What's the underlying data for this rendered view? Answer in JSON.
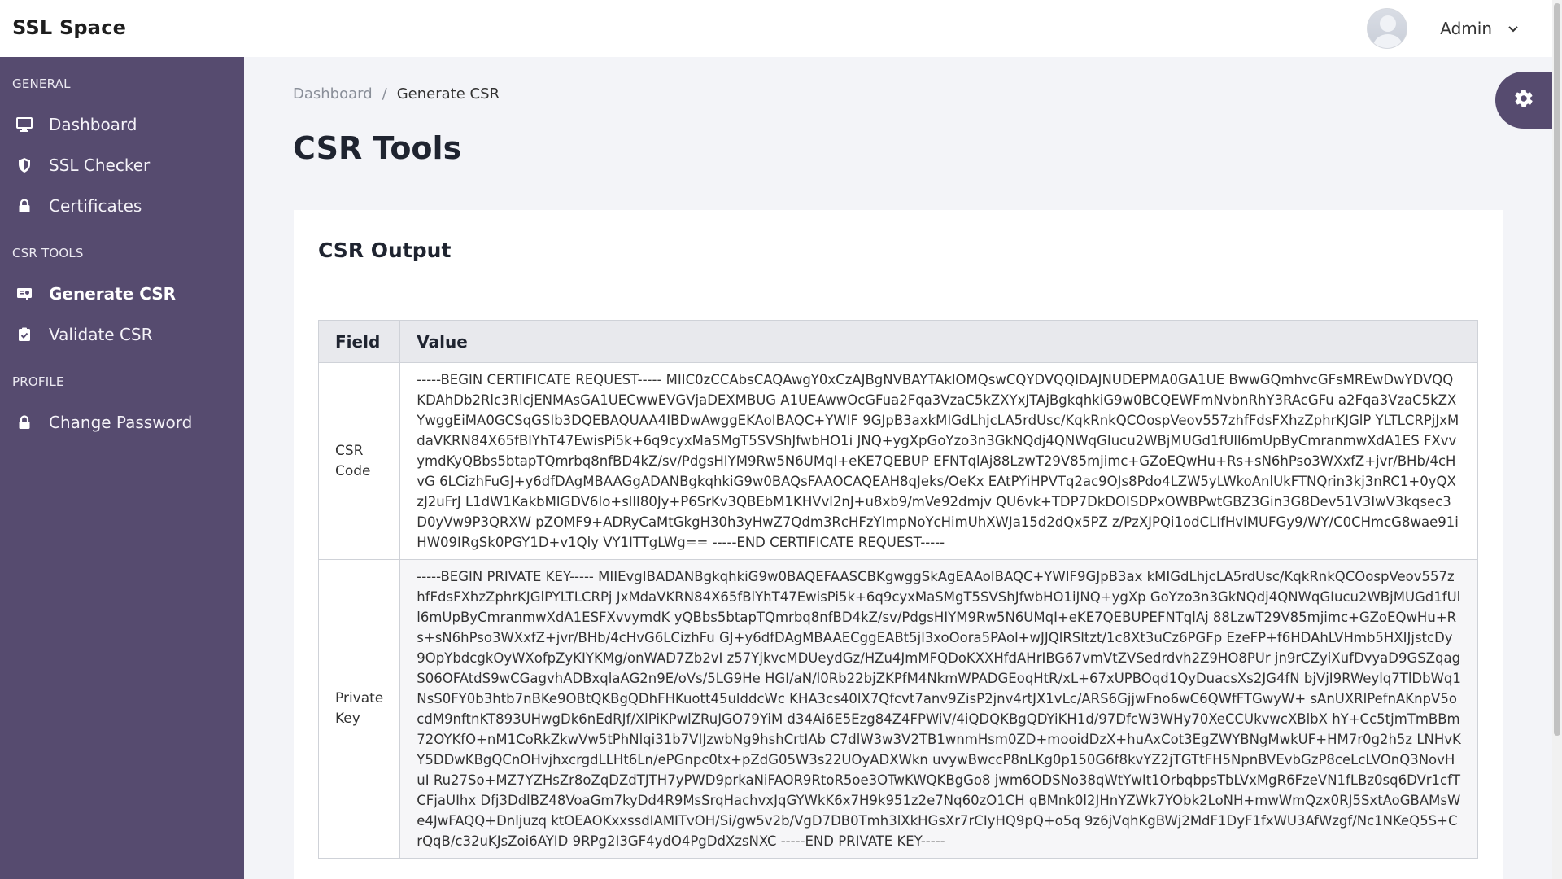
{
  "app": {
    "brand": "SSL Space"
  },
  "user": {
    "name": "Admin"
  },
  "sidebar": {
    "sections": [
      {
        "label": "GENERAL"
      },
      {
        "label": "CSR TOOLS"
      },
      {
        "label": "PROFILE"
      }
    ],
    "items": [
      {
        "label": "Dashboard",
        "icon": "monitor-icon"
      },
      {
        "label": "SSL Checker",
        "icon": "shield-icon"
      },
      {
        "label": "Certificates",
        "icon": "lock-icon"
      },
      {
        "label": "Generate CSR",
        "icon": "csr-icon",
        "active": true
      },
      {
        "label": "Validate CSR",
        "icon": "clipboard-check-icon"
      },
      {
        "label": "Change Password",
        "icon": "lock-icon"
      }
    ]
  },
  "breadcrumb": {
    "parent": "Dashboard",
    "separator": "/",
    "current": "Generate CSR"
  },
  "page": {
    "title": "CSR Tools"
  },
  "card": {
    "title": "CSR Output",
    "table": {
      "headers": [
        "Field",
        "Value"
      ],
      "rows": [
        {
          "field": "CSR Code",
          "value": "-----BEGIN CERTIFICATE REQUEST----- MIIC0zCCAbsCAQAwgY0xCzAJBgNVBAYTAklOMQswCQYDVQQIDAJNUDEPMA0GA1UE BwwGQmhvcGFsMREwDwYDVQQKDAhDb2Rlc3RlcjENMAsGA1UECwwEVGVjaDEXMBUG A1UEAwwOcGFua2Fqa3VzaC5kZXYxJTAjBgkqhkiG9w0BCQEWFmNvbnRhY3RAcGFu a2Fqa3VzaC5kZXYwggEiMA0GCSqGSIb3DQEBAQUAA4IBDwAwggEKAoIBAQC+YWIF 9GJpB3axkMIGdLhjcLA5rdUsc/KqkRnkQCOospVeov557zhfFdsFXhzZphrKJGlP YLTLCRPjJxMdaVKRN84X65fBlYhT47EwisPi5k+6q9cyxMaSMgT5SVShJfwbHO1i JNQ+ygXpGoYzo3n3GkNQdj4QNWqGIucu2WBjMUGd1fUll6mUpByCmranmwXdA1ES FXvvymdKyQBbs5btapTQmrbq8nfBD4kZ/sv/PdgsHIYM9Rw5N6UMqI+eKE7QEBUP EFNTqlAj88LzwT29V85mjimc+GZoEQwHu+Rs+sN6hPso3WXxfZ+jvr/BHb/4cHvG 6LCizhFuGJ+y6dfDAgMBAAGgADANBgkqhkiG9w0BAQsFAAOCAQEAH8qJeks/OeKx EAtPYiHPVTq2ac9OJs8Pdo4LZW5yLWkoAnlUkFTNQrin3kj3nRC1+0yQXzJ2uFrJ L1dW1KakbMlGDV6Io+sllI80Jy+P6SrKv3QBEbM1KHVvl2nJ+u8xb9/mVe92dmjv QU6vk+TDP7DkDOISDPxOWBPwtGBZ3Gin3G8Dev51V3IwV3kqsec3D0yVw9P3QRXW pZOMF9+ADRyCaMtGkgH30h3yHwZ7Qdm3RcHFzYImpNoYcHimUhXWJa15d2dQx5PZ z/PzXJPQi1odCLIfHvlMUFGy9/WY/C0CHmcG8wae91iHW09IRgSk0PGY1D+v1Qly VY1ITTgLWg== -----END CERTIFICATE REQUEST-----"
        },
        {
          "field": "Private Key",
          "value": "-----BEGIN PRIVATE KEY----- MIIEvgIBADANBgkqhkiG9w0BAQEFAASCBKgwggSkAgEAAoIBAQC+YWIF9GJpB3ax kMIGdLhjcLA5rdUsc/KqkRnkQCOospVeov557zhfFdsFXhzZphrKJGlPYLTLCRPj JxMdaVKRN84X65fBlYhT47EwisPi5k+6q9cyxMaSMgT5SVShJfwbHO1iJNQ+ygXp GoYzo3n3GkNQdj4QNWqGIucu2WBjMUGd1fUll6mUpByCmranmwXdA1ESFXvvymdK yQBbs5btapTQmrbq8nfBD4kZ/sv/PdgsHIYM9Rw5N6UMqI+eKE7QEBUPEFNTqlAj 88LzwT29V85mjimc+GZoEQwHu+Rs+sN6hPso3WXxfZ+jvr/BHb/4cHvG6LCizhFu GJ+y6dfDAgMBAAECggEABt5jl3xoOora5PAol+wJJQlRSltzt/1c8Xt3uCz6PGFp EzeFP+f6HDAhLVHmb5HXIJjstcDy9OpYbdcgkOyWXofpZyKIYKMg/onWAD7Zb2vI z57YjkvcMDUeydGz/HZu4JmMFQDoKXXHfdAHrIBG67vmVtZVSedrdvh2Z9HO8PUr jn9rCZyiXufDvyaD9GSZqagS06OFAtdS9wCGagvhADBxqlaAG2n9E/oVs/5LG9He HGI/aN/l0Rb22bjZKPfM4NkmWPADGEoqHtR/xL+67xUPBOqd1QyDuacsXs2JG4fN bjVjI9RWeylq7TlDbWq1NsS0FY0b3htb7nBKe9OBtQKBgQDhFHKuott45ulddcWc KHA3cs40lX7Qfcvt7anv9ZisP2jnv4rtJX1vLc/ARS6GjjwFno6wC6QWfFTGwyW+ sAnUXRlPefnAKnpV5ocdM9nftnKT893UHwgDk6nEdRJf/XlPiKPwlZRuJGO79YiM d34Ai6E5Ezg84Z4FPWiV/4iQDQKBgQDYiKH1d/97DfcW3WHy70XeCCUkvwcXBlbX hY+Cc5tjmTmBBm72OYKfO+nM1CoRkZkwVw5tPhNlqi31b7VIJzwbNg9hshCrtIAb C7dlW3w3V2TB1wnmHsm0ZD+mooidDzX+huAxCot3EgZWYBNgMwkUF+HM7r0g2h5z LNHvKY5DDwKBgQCnOHvjhxcrgdLLHt6Ln/ePGnpc0tx+pZdG05W3s22UOyADXWkn uvywBwccP8nLKg0p150G6f8kvYZ2jTGTtFH5NpnBVEvbGzP8ceLcLVOnQ3NovHuI Ru27So+MZ7YZHsZr8oZqDZdTJTH7yPWD9prkaNiFAOR9RtoR5oe3OTwKWQKBgGo8 jwm6ODSNo38qWtYwIt1OrbqbpsTbLVxMgR6FzeVN1fLBz0sq6DVr1cfTCFjaUIhx Dfj3DdlBZ48VoaGm7kyDd4R9MsSrqHachvxJqGYWkK6x7H9k951z2e7Nq60zO1CH qBMnk0l2JHnYZWk7YObk2LoNH+mwWmQzx0RJ5SxtAoGBAMsWe4JwFAQQ+Dnljuzq ktOEAOKxxssdIAMITvOH/Si/gw5v2b/VgD7DB0Tmh3lXkHGsXr7rCIyHQ9pQ+o5q 9z6jVqhKgBWj2MdF1DyF1fxWU3AfWzgf/Nc1NKeQ5S+CrQqB/c32uKJsZoi6AYID 9RPg2I3GF4ydO4PgDdXzsNXC -----END PRIVATE KEY-----"
        }
      ]
    }
  },
  "colors": {
    "sidebar": "#564b6f",
    "accent": "#564b6f"
  }
}
